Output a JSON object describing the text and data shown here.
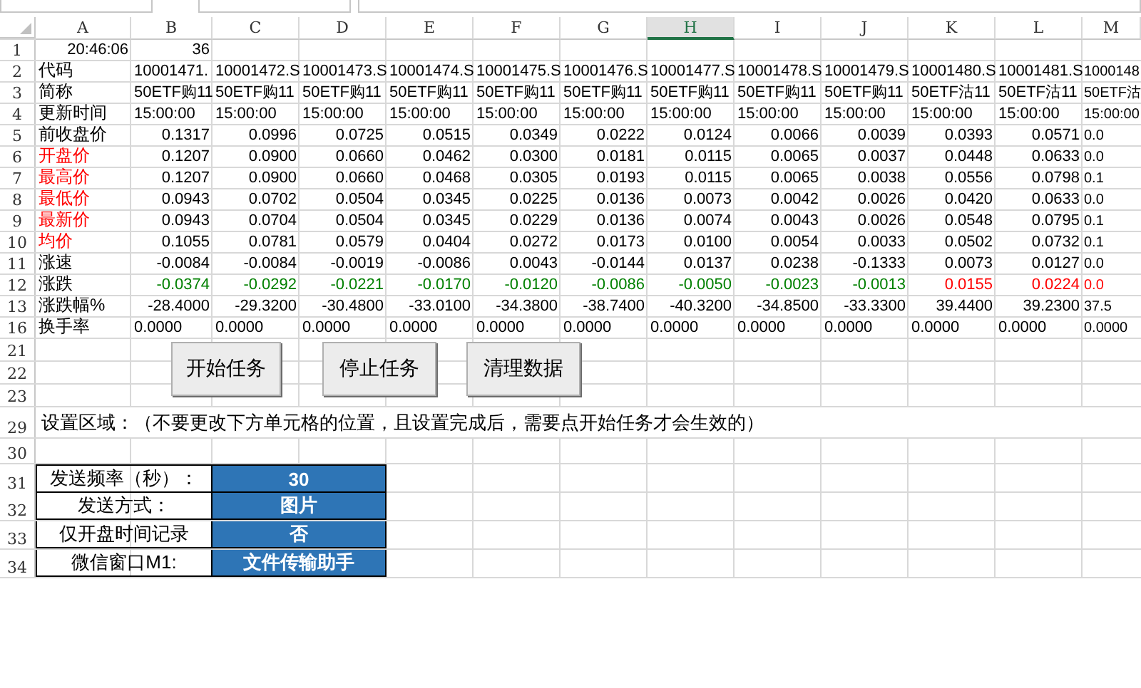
{
  "columns": [
    {
      "label": "A",
      "selected": false
    },
    {
      "label": "B",
      "selected": false
    },
    {
      "label": "C",
      "selected": false
    },
    {
      "label": "D",
      "selected": false
    },
    {
      "label": "E",
      "selected": false
    },
    {
      "label": "F",
      "selected": false
    },
    {
      "label": "G",
      "selected": false
    },
    {
      "label": "H",
      "selected": true
    },
    {
      "label": "I",
      "selected": false
    },
    {
      "label": "J",
      "selected": false
    },
    {
      "label": "K",
      "selected": false
    },
    {
      "label": "L",
      "selected": false
    },
    {
      "label": "M",
      "selected": false
    }
  ],
  "rows": [
    {
      "number": "1",
      "kind": "clock",
      "label": "20:46:06",
      "cells": [
        {
          "text": "36"
        }
      ]
    },
    {
      "number": "2",
      "kind": "text",
      "label": "代码",
      "cells": [
        {
          "text": "10001471."
        },
        {
          "text": "10001472.S"
        },
        {
          "text": "10001473.S"
        },
        {
          "text": "10001474.S"
        },
        {
          "text": "10001475.S"
        },
        {
          "text": "10001476.S"
        },
        {
          "text": "10001477.S"
        },
        {
          "text": "10001478.S"
        },
        {
          "text": "10001479.S"
        },
        {
          "text": "10001480.S"
        },
        {
          "text": "10001481.S"
        },
        {
          "text": "1000148"
        }
      ]
    },
    {
      "number": "3",
      "kind": "text",
      "label": "简称",
      "cells": [
        {
          "text": "50ETF购11"
        },
        {
          "text": "50ETF购11"
        },
        {
          "text": "50ETF购11"
        },
        {
          "text": "50ETF购11"
        },
        {
          "text": "50ETF购11"
        },
        {
          "text": "50ETF购11"
        },
        {
          "text": "50ETF购11"
        },
        {
          "text": "50ETF购11"
        },
        {
          "text": "50ETF购11"
        },
        {
          "text": "50ETF沽11"
        },
        {
          "text": "50ETF沽11"
        },
        {
          "text": "50ETF沽"
        }
      ]
    },
    {
      "number": "4",
      "kind": "text",
      "label": "更新时间",
      "cells": [
        {
          "text": "15:00:00"
        },
        {
          "text": "15:00:00"
        },
        {
          "text": "15:00:00"
        },
        {
          "text": "15:00:00"
        },
        {
          "text": "15:00:00"
        },
        {
          "text": "15:00:00"
        },
        {
          "text": "15:00:00"
        },
        {
          "text": "15:00:00"
        },
        {
          "text": "15:00:00"
        },
        {
          "text": "15:00:00"
        },
        {
          "text": "15:00:00"
        },
        {
          "text": "15:00:00"
        }
      ]
    },
    {
      "number": "5",
      "kind": "number",
      "label": "前收盘价",
      "cells": [
        {
          "text": "0.1317"
        },
        {
          "text": "0.0996"
        },
        {
          "text": "0.0725"
        },
        {
          "text": "0.0515"
        },
        {
          "text": "0.0349"
        },
        {
          "text": "0.0222"
        },
        {
          "text": "0.0124"
        },
        {
          "text": "0.0066"
        },
        {
          "text": "0.0039"
        },
        {
          "text": "0.0393"
        },
        {
          "text": "0.0571"
        },
        {
          "text": "0.0"
        }
      ]
    },
    {
      "number": "6",
      "kind": "number",
      "label": "开盘价",
      "color": "#ff0000",
      "cells": [
        {
          "text": "0.1207"
        },
        {
          "text": "0.0900"
        },
        {
          "text": "0.0660"
        },
        {
          "text": "0.0462"
        },
        {
          "text": "0.0300"
        },
        {
          "text": "0.0181"
        },
        {
          "text": "0.0115"
        },
        {
          "text": "0.0065"
        },
        {
          "text": "0.0037"
        },
        {
          "text": "0.0448"
        },
        {
          "text": "0.0633"
        },
        {
          "text": "0.0"
        }
      ]
    },
    {
      "number": "7",
      "kind": "number",
      "label": "最高价",
      "color": "#ff0000",
      "cells": [
        {
          "text": "0.1207"
        },
        {
          "text": "0.0900"
        },
        {
          "text": "0.0660"
        },
        {
          "text": "0.0468"
        },
        {
          "text": "0.0305"
        },
        {
          "text": "0.0193"
        },
        {
          "text": "0.0115"
        },
        {
          "text": "0.0065"
        },
        {
          "text": "0.0038"
        },
        {
          "text": "0.0556"
        },
        {
          "text": "0.0798"
        },
        {
          "text": "0.1"
        }
      ]
    },
    {
      "number": "8",
      "kind": "number",
      "label": "最低价",
      "color": "#ff0000",
      "cells": [
        {
          "text": "0.0943"
        },
        {
          "text": "0.0702"
        },
        {
          "text": "0.0504"
        },
        {
          "text": "0.0345"
        },
        {
          "text": "0.0225"
        },
        {
          "text": "0.0136"
        },
        {
          "text": "0.0073"
        },
        {
          "text": "0.0042"
        },
        {
          "text": "0.0026"
        },
        {
          "text": "0.0420"
        },
        {
          "text": "0.0633"
        },
        {
          "text": "0.0"
        }
      ]
    },
    {
      "number": "9",
      "kind": "number",
      "label": "最新价",
      "color": "#ff0000",
      "cells": [
        {
          "text": "0.0943"
        },
        {
          "text": "0.0704"
        },
        {
          "text": "0.0504"
        },
        {
          "text": "0.0345"
        },
        {
          "text": "0.0229"
        },
        {
          "text": "0.0136"
        },
        {
          "text": "0.0074"
        },
        {
          "text": "0.0043"
        },
        {
          "text": "0.0026"
        },
        {
          "text": "0.0548"
        },
        {
          "text": "0.0795"
        },
        {
          "text": "0.1"
        }
      ]
    },
    {
      "number": "10",
      "kind": "number",
      "label": "均价",
      "color": "#ff0000",
      "cells": [
        {
          "text": "0.1055"
        },
        {
          "text": "0.0781"
        },
        {
          "text": "0.0579"
        },
        {
          "text": "0.0404"
        },
        {
          "text": "0.0272"
        },
        {
          "text": "0.0173"
        },
        {
          "text": "0.0100"
        },
        {
          "text": "0.0054"
        },
        {
          "text": "0.0033"
        },
        {
          "text": "0.0502"
        },
        {
          "text": "0.0732"
        },
        {
          "text": "0.1"
        }
      ]
    },
    {
      "number": "11",
      "kind": "number",
      "label": "涨速",
      "cells": [
        {
          "text": "-0.0084"
        },
        {
          "text": "-0.0084"
        },
        {
          "text": "-0.0019"
        },
        {
          "text": "-0.0086"
        },
        {
          "text": "0.0043"
        },
        {
          "text": "-0.0144"
        },
        {
          "text": "0.0137"
        },
        {
          "text": "0.0238"
        },
        {
          "text": "-0.1333"
        },
        {
          "text": "0.0073"
        },
        {
          "text": "0.0127"
        },
        {
          "text": "0.0"
        }
      ]
    },
    {
      "number": "12",
      "kind": "number",
      "label": "涨跌",
      "cells": [
        {
          "text": "-0.0374",
          "color": "#008000"
        },
        {
          "text": "-0.0292",
          "color": "#008000"
        },
        {
          "text": "-0.0221",
          "color": "#008000"
        },
        {
          "text": "-0.0170",
          "color": "#008000"
        },
        {
          "text": "-0.0120",
          "color": "#008000"
        },
        {
          "text": "-0.0086",
          "color": "#008000"
        },
        {
          "text": "-0.0050",
          "color": "#008000"
        },
        {
          "text": "-0.0023",
          "color": "#008000"
        },
        {
          "text": "-0.0013",
          "color": "#008000"
        },
        {
          "text": "0.0155",
          "color": "#ff0000"
        },
        {
          "text": "0.0224",
          "color": "#ff0000"
        },
        {
          "text": "0.0",
          "color": "#ff0000"
        }
      ]
    },
    {
      "number": "13",
      "kind": "number",
      "label": "涨跌幅%",
      "cells": [
        {
          "text": "-28.4000"
        },
        {
          "text": "-29.3200"
        },
        {
          "text": "-30.4800"
        },
        {
          "text": "-33.0100"
        },
        {
          "text": "-34.3800"
        },
        {
          "text": "-38.7400"
        },
        {
          "text": "-40.3200"
        },
        {
          "text": "-34.8500"
        },
        {
          "text": "-33.3300"
        },
        {
          "text": "39.4400"
        },
        {
          "text": "39.2300"
        },
        {
          "text": "37.5"
        }
      ]
    },
    {
      "number": "16",
      "kind": "text",
      "label": "换手率",
      "cells": [
        {
          "text": "0.0000"
        },
        {
          "text": "0.0000"
        },
        {
          "text": "0.0000"
        },
        {
          "text": "0.0000"
        },
        {
          "text": "0.0000"
        },
        {
          "text": "0.0000"
        },
        {
          "text": "0.0000"
        },
        {
          "text": "0.0000"
        },
        {
          "text": "0.0000"
        },
        {
          "text": "0.0000"
        },
        {
          "text": "0.0000"
        },
        {
          "text": "0.0000"
        }
      ]
    }
  ],
  "button_rows": [
    "21",
    "22",
    "23"
  ],
  "buttons": [
    "开始任务",
    "停止任务",
    "清理数据"
  ],
  "note": {
    "number": "29",
    "text": "设置区域：（不要更改下方单元格的位置，且设置完成后，需要点开始任务才会生效的）"
  },
  "blank_row": "30",
  "settings": [
    {
      "number": "31",
      "label": "发送频率（秒）：",
      "value": "30"
    },
    {
      "number": "32",
      "label": "发送方式：",
      "value": "图片"
    },
    {
      "number": "33",
      "label": "仅开盘时间记录",
      "value": "否"
    },
    {
      "number": "34",
      "label": "微信窗口M1:",
      "value": "文件传输助手"
    }
  ]
}
